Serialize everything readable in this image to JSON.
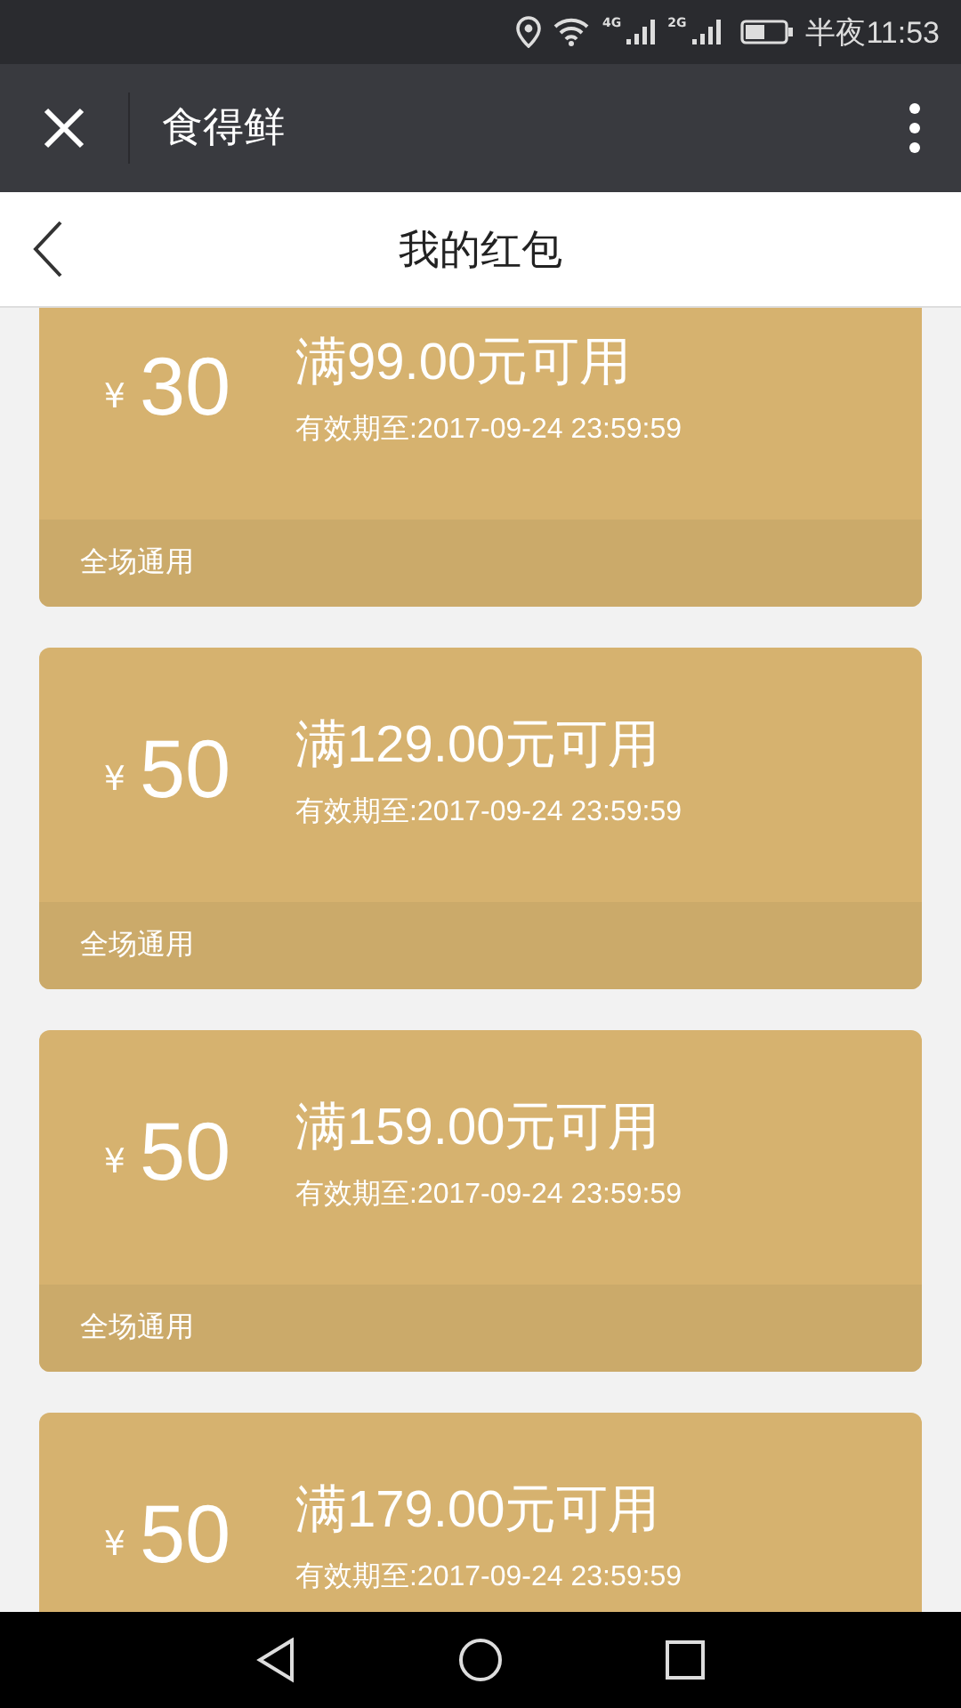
{
  "status_bar": {
    "network_1": "4G",
    "network_2": "2G",
    "time": "半夜11:53"
  },
  "app_bar": {
    "title": "食得鲜"
  },
  "header": {
    "title": "我的红包"
  },
  "coupons": [
    {
      "currency": "¥",
      "amount": "30",
      "condition": "满99.00元可用",
      "expiry": "有效期至:2017-09-24 23:59:59",
      "scope": "全场通用"
    },
    {
      "currency": "¥",
      "amount": "50",
      "condition": "满129.00元可用",
      "expiry": "有效期至:2017-09-24 23:59:59",
      "scope": "全场通用"
    },
    {
      "currency": "¥",
      "amount": "50",
      "condition": "满159.00元可用",
      "expiry": "有效期至:2017-09-24 23:59:59",
      "scope": "全场通用"
    },
    {
      "currency": "¥",
      "amount": "50",
      "condition": "满179.00元可用",
      "expiry": "有效期至:2017-09-24 23:59:59"
    }
  ]
}
